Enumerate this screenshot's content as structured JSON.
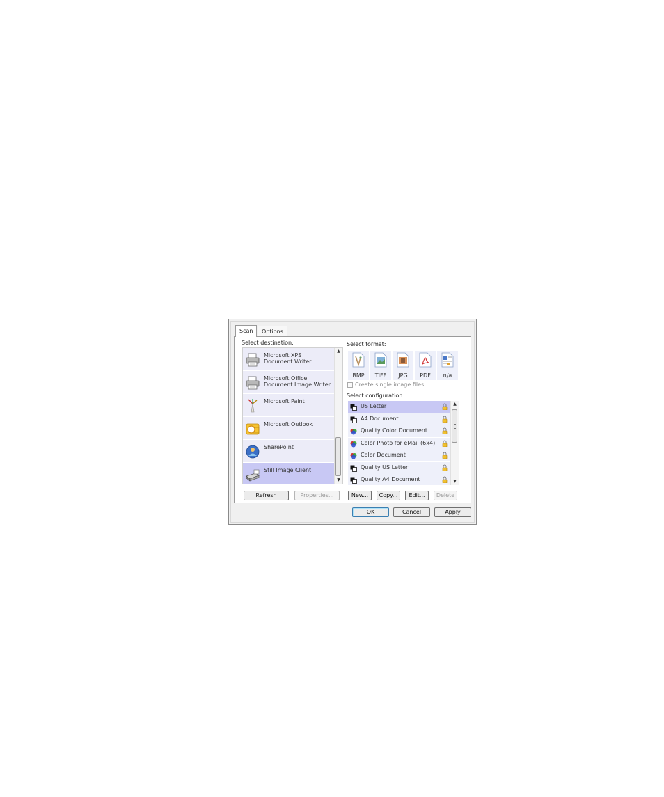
{
  "tabs": [
    {
      "label": "Scan"
    },
    {
      "label": "Options"
    }
  ],
  "destination": {
    "label": "Select destination:",
    "items": [
      {
        "label": "Microsoft XPS Document Writer",
        "icon": "printer-icon",
        "selected": false
      },
      {
        "label": "Microsoft Office Document Image Writer",
        "icon": "printer-icon",
        "selected": false
      },
      {
        "label": "Microsoft Paint",
        "icon": "paint-brushes-icon",
        "selected": false
      },
      {
        "label": "Microsoft Outlook",
        "icon": "outlook-icon",
        "selected": false
      },
      {
        "label": "SharePoint",
        "icon": "sharepoint-icon",
        "selected": false
      },
      {
        "label": "Still Image Client",
        "icon": "scanner-icon",
        "selected": true
      }
    ],
    "refresh_label": "Refresh",
    "properties_label": "Properties..."
  },
  "format": {
    "label": "Select format:",
    "items": [
      {
        "label": "BMP",
        "icon": "bmp-file-icon"
      },
      {
        "label": "TIFF",
        "icon": "tiff-file-icon"
      },
      {
        "label": "JPG",
        "icon": "jpg-file-icon"
      },
      {
        "label": "PDF",
        "icon": "pdf-file-icon"
      },
      {
        "label": "n/a",
        "icon": "text-file-icon"
      }
    ],
    "single_image_label": "Create single image files",
    "single_image_checked": false
  },
  "configuration": {
    "label": "Select configuration:",
    "items": [
      {
        "label": "US Letter",
        "icon": "black-white-icon",
        "selected": true
      },
      {
        "label": "A4 Document",
        "icon": "black-white-icon",
        "selected": false
      },
      {
        "label": "Quality Color Document",
        "icon": "color-icon",
        "selected": false
      },
      {
        "label": "Color Photo for eMail (6x4)",
        "icon": "color-icon",
        "selected": false
      },
      {
        "label": "Color Document",
        "icon": "color-icon",
        "selected": false
      },
      {
        "label": "Quality US Letter",
        "icon": "black-white-icon",
        "selected": false
      },
      {
        "label": "Quality A4 Document",
        "icon": "black-white-icon",
        "selected": false
      }
    ],
    "new_label": "New...",
    "copy_label": "Copy...",
    "edit_label": "Edit...",
    "delete_label": "Delete"
  },
  "footer": {
    "ok_label": "OK",
    "cancel_label": "Cancel",
    "apply_label": "Apply"
  },
  "colors": {
    "selection": "#c8c8f4",
    "item_background": "#ececf8",
    "dialog_background": "#f0f0f0"
  }
}
